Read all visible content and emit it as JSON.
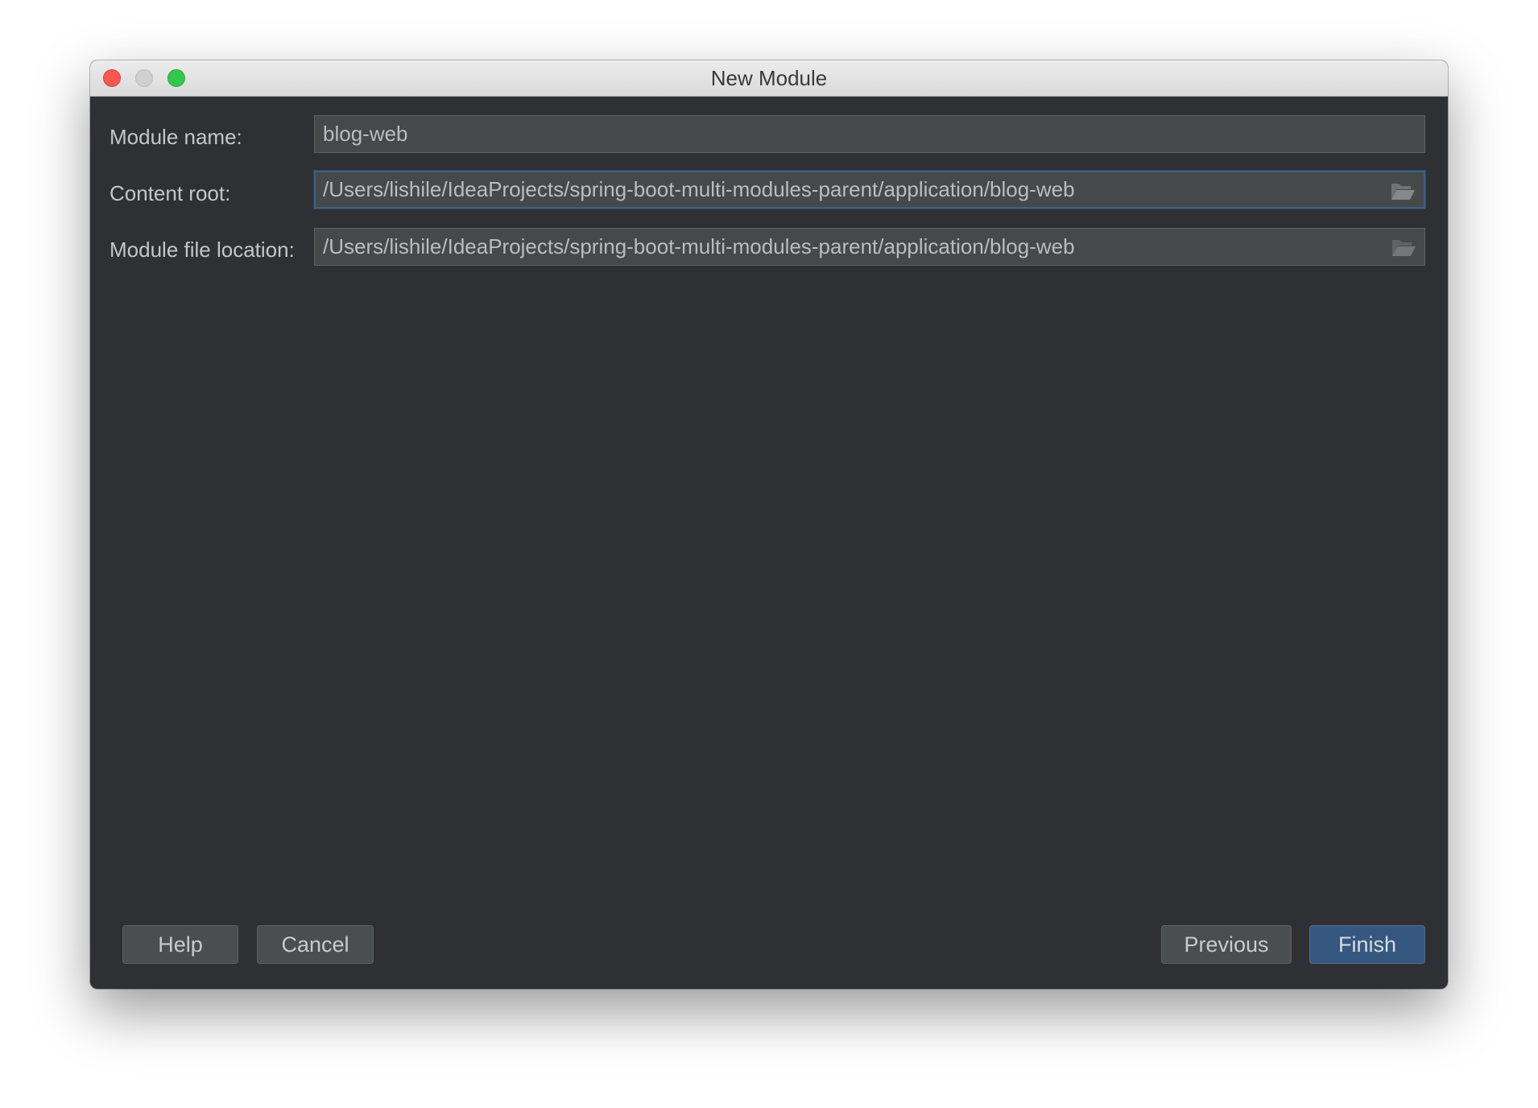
{
  "window": {
    "title": "New Module"
  },
  "form": {
    "module_name": {
      "label": "Module name:",
      "value": "blog-web"
    },
    "content_root": {
      "label": "Content root:",
      "value": "/Users/lishile/IdeaProjects/spring-boot-multi-modules-parent/application/blog-web",
      "icon": "folder-icon"
    },
    "module_file_location": {
      "label": "Module file location:",
      "value": "/Users/lishile/IdeaProjects/spring-boot-multi-modules-parent/application/blog-web",
      "icon": "folder-icon"
    }
  },
  "buttons": {
    "help": "Help",
    "cancel": "Cancel",
    "previous": "Previous",
    "finish": "Finish"
  },
  "colors": {
    "dialog_background": "#2f3033",
    "field_background": "#45494a",
    "focus_border": "#3d6185",
    "primary_button": "#365880",
    "close": "#fc5753",
    "maximize": "#34c84a"
  }
}
